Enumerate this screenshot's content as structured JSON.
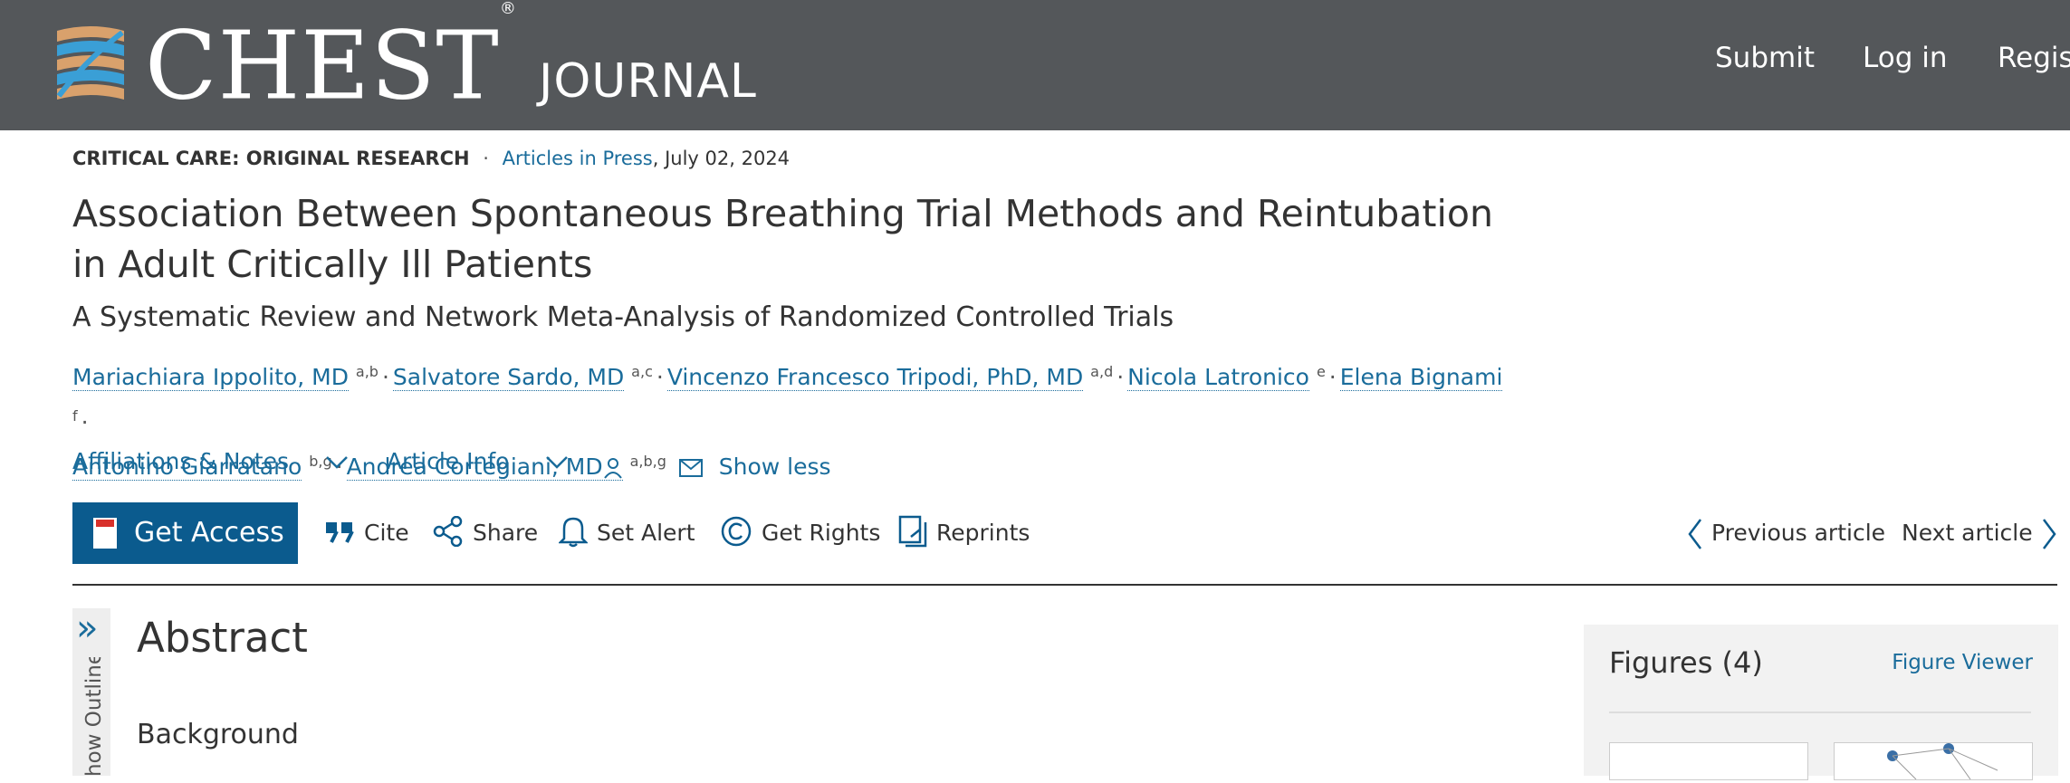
{
  "header": {
    "brand": "CHEST",
    "registered": "®",
    "journal": "JOURNAL",
    "nav": [
      "Submit",
      "Log in",
      "Regist"
    ]
  },
  "article": {
    "section": "CRITICAL CARE: ORIGINAL RESEARCH",
    "separator": "·",
    "status": "Articles in Press",
    "date": ", July 02, 2024",
    "title": "Association Between Spontaneous Breathing Trial Methods and Reintubation in Adult Critically Ill Patients",
    "subtitle": "A Systematic Review and Network Meta-Analysis of Randomized Controlled Trials",
    "authors": [
      {
        "name": "Mariachiara Ippolito, MD",
        "aff": "a,b"
      },
      {
        "name": "Salvatore Sardo, MD",
        "aff": "a,c"
      },
      {
        "name": "Vincenzo Francesco Tripodi, PhD, MD",
        "aff": "a,d"
      },
      {
        "name": "Nicola Latronico",
        "aff": "e"
      },
      {
        "name": "Elena Bignami",
        "aff": "f"
      },
      {
        "name": "Antonino Giarratano",
        "aff": "b,g"
      },
      {
        "name": "Andrea Cortegiani, MD",
        "aff": "a,b,g"
      }
    ],
    "show_less": "Show less",
    "affiliations_label": "Affiliations & Notes",
    "article_info_label": "Article Info"
  },
  "toolbar": {
    "get_access": "Get Access",
    "cite": "Cite",
    "share": "Share",
    "set_alert": "Set Alert",
    "get_rights": "Get Rights",
    "reprints": "Reprints",
    "previous": "Previous article",
    "next": "Next article"
  },
  "outline": {
    "label": "Show Outline"
  },
  "body": {
    "abstract_heading": "Abstract",
    "background_heading": "Background"
  },
  "figures": {
    "title": "Figures (4)",
    "viewer": "Figure Viewer"
  },
  "colors": {
    "header_bg": "#54575a",
    "link": "#1a6c9b",
    "access_button": "#0b5b8e",
    "logo_blue": "#3a9fd6",
    "logo_tan": "#d9a16c"
  }
}
